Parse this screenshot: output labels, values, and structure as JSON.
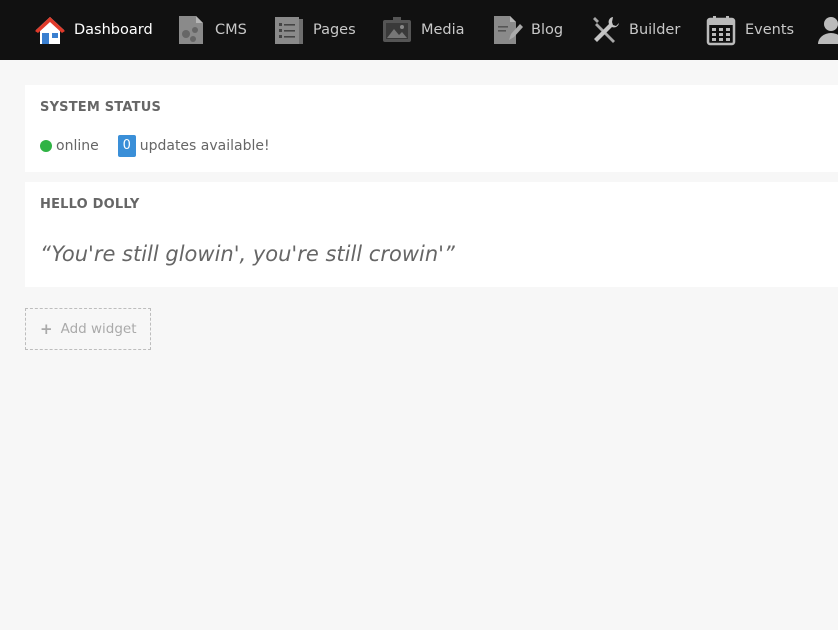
{
  "nav": {
    "items": [
      {
        "label": "Dashboard",
        "icon": "home-icon",
        "active": true
      },
      {
        "label": "CMS",
        "icon": "cms-icon"
      },
      {
        "label": "Pages",
        "icon": "pages-icon"
      },
      {
        "label": "Media",
        "icon": "media-icon"
      },
      {
        "label": "Blog",
        "icon": "blog-icon"
      },
      {
        "label": "Builder",
        "icon": "builder-icon"
      },
      {
        "label": "Events",
        "icon": "events-icon"
      },
      {
        "label": "",
        "icon": "user-icon"
      }
    ]
  },
  "system_status": {
    "title": "SYSTEM STATUS",
    "status_text": "online",
    "status_color": "#2fb344",
    "updates_count": "0",
    "updates_text": "updates available!"
  },
  "hello_dolly": {
    "title": "HELLO DOLLY",
    "quote": "“You're still glowin', you're still crowin'”"
  },
  "add_widget": {
    "label": "Add widget"
  },
  "colors": {
    "nav_bg": "#111111",
    "badge": "#3a8fd8",
    "page_bg": "#f7f7f7"
  }
}
